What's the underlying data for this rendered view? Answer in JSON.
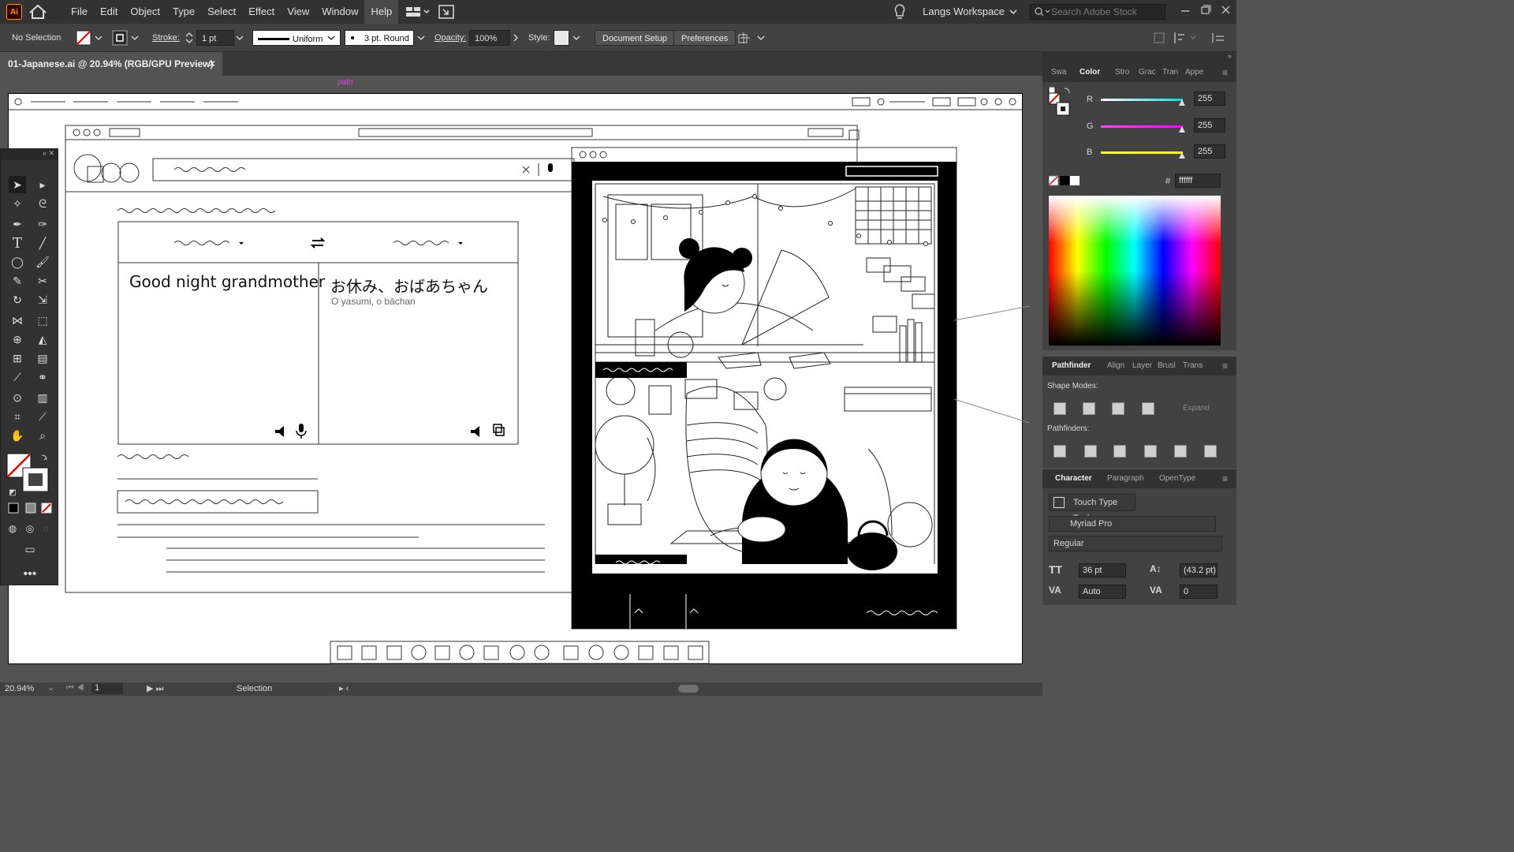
{
  "app": {
    "logo": "Ai"
  },
  "menu": [
    "File",
    "Edit",
    "Object",
    "Type",
    "Select",
    "Effect",
    "View",
    "Window",
    "Help"
  ],
  "workspace": {
    "name": "Langs Workspace",
    "search_placeholder": "Search Adobe Stock"
  },
  "control": {
    "selection": "No Selection",
    "stroke_label": "Stroke:",
    "stroke_value": "1 pt",
    "profile": "Uniform",
    "brush": "3 pt. Round",
    "opacity_label": "Opacity:",
    "opacity_value": "100%",
    "style_label": "Style:",
    "document_setup": "Document Setup",
    "preferences": "Preferences"
  },
  "document": {
    "tab": "01-Japanese.ai @ 20.94% (RGB/GPU Preview)",
    "smart_guide": "path"
  },
  "art": {
    "source_text": "Good night grandmother",
    "target_text": "お休み、おばあちゃん",
    "romaji": "O yasumi, o bāchan"
  },
  "color_panel": {
    "tabs": [
      "Swa",
      "Color",
      "Stro",
      "Grac",
      "Tran",
      "Appe"
    ],
    "r_label": "R",
    "r_value": "255",
    "g_label": "G",
    "g_value": "255",
    "b_label": "B",
    "b_value": "255",
    "hex_label": "#",
    "hex_value": "ffffff"
  },
  "pathfinder_panel": {
    "tabs": [
      "Pathfinder",
      "Align",
      "Layer",
      "Brusl",
      "Trans"
    ],
    "shape_modes": "Shape Modes:",
    "pathfinders": "Pathfinders:",
    "expand": "Expand"
  },
  "character_panel": {
    "tabs": [
      "Character",
      "Paragraph",
      "OpenType"
    ],
    "touch_type": "Touch Type Tool",
    "font": "Myriad Pro",
    "style": "Regular",
    "size": "36 pt",
    "leading": "(43.2 pt)",
    "kerning": "Auto",
    "tracking": "0"
  },
  "status": {
    "zoom": "20.94%",
    "artboard": "1",
    "tool": "Selection"
  },
  "colors": {
    "accent": "#ff9a00",
    "r_track": "#00d0e0",
    "g_track": "#e040e0",
    "b_track": "#f0f000",
    "guide": "#e040e0"
  }
}
